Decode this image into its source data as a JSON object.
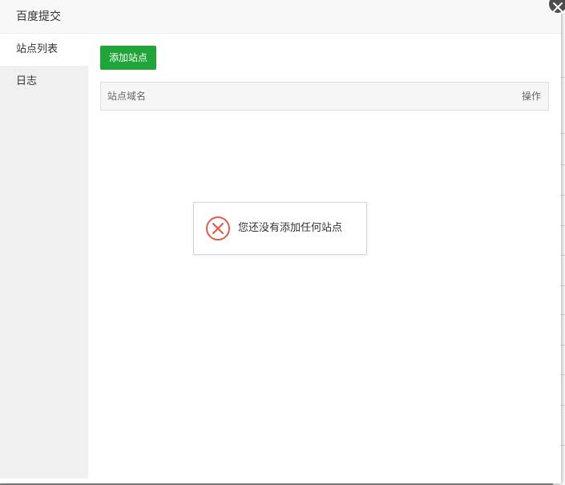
{
  "dialog": {
    "title": "百度提交"
  },
  "sidebar": {
    "items": [
      {
        "label": "站点列表",
        "active": true
      },
      {
        "label": "日志",
        "active": false
      }
    ]
  },
  "toolbar": {
    "add_label": "添加站点",
    "add_color": "#20a53a"
  },
  "table": {
    "columns": [
      "站点域名",
      "操作"
    ],
    "rows": []
  },
  "toast": {
    "message": "您还没有添加任何站点",
    "icon": "error-circle-icon",
    "icon_color": "#e05b4b"
  },
  "icons": {
    "close": "close-icon"
  }
}
